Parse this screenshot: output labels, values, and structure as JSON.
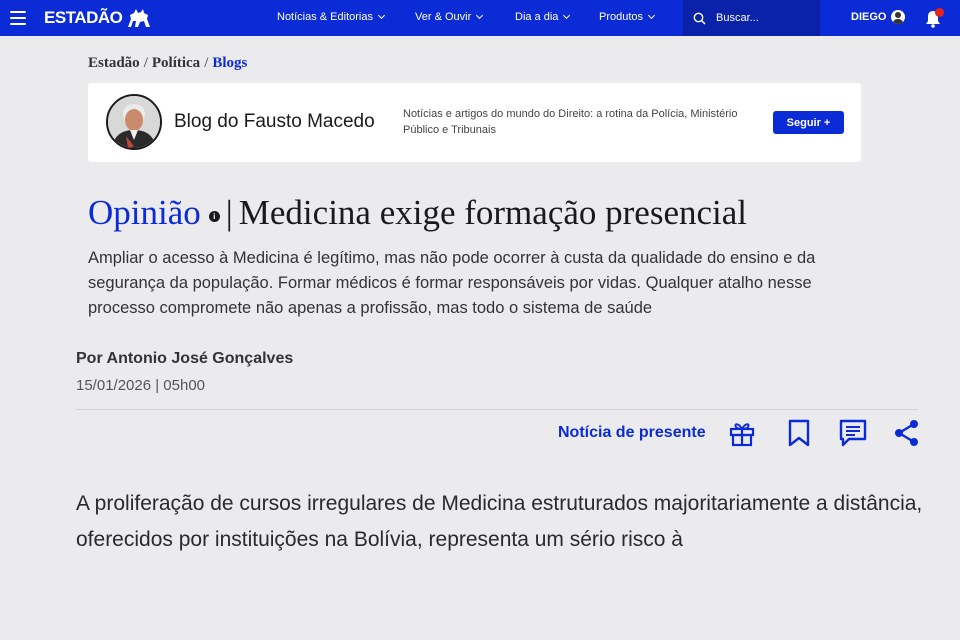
{
  "topbar": {
    "logo_text": "ESTADÃO",
    "nav": [
      {
        "label": "Notícias & Editorias"
      },
      {
        "label": "Ver & Ouvir"
      },
      {
        "label": "Dia a dia"
      },
      {
        "label": "Produtos"
      }
    ],
    "search_placeholder": "Buscar...",
    "user_name": "DIEGO",
    "accent_color": "#0b2bd6",
    "notification_dot_color": "#e5231b"
  },
  "breadcrumb": [
    "Estadão",
    "Política",
    "Blogs"
  ],
  "blog": {
    "name": "Blog do Fausto Macedo",
    "description": "Notícias e artigos do mundo do Direito: a rotina da Polícia, Ministério Público e Tribunais",
    "follow_label": "Seguir +"
  },
  "article": {
    "section": "Opinião",
    "info_glyph": "i",
    "separator": "|",
    "title": "Medicina exige formação presencial",
    "subtitle": "Ampliar o acesso à Medicina é legítimo, mas não pode ocorrer à custa da qualidade do ensino e da segurança da população. Formar médicos é formar responsáveis por vidas. Qualquer atalho nesse processo compromete não apenas a profissão, mas todo o sistema de saúde",
    "author": "Por Antonio José Gonçalves",
    "date": "15/01/2026 | 05h00",
    "gift_label": "Notícia de presente",
    "body": "A proliferação de cursos irregulares de Medicina estruturados majoritariamente a distância, oferecidos por instituições na Bolívia, representa um sério risco à"
  },
  "icons": [
    "menu-icon",
    "horse-logo-icon",
    "search-icon",
    "user-icon",
    "bell-icon",
    "gift-icon",
    "bookmark-icon",
    "comment-icon",
    "share-icon"
  ]
}
